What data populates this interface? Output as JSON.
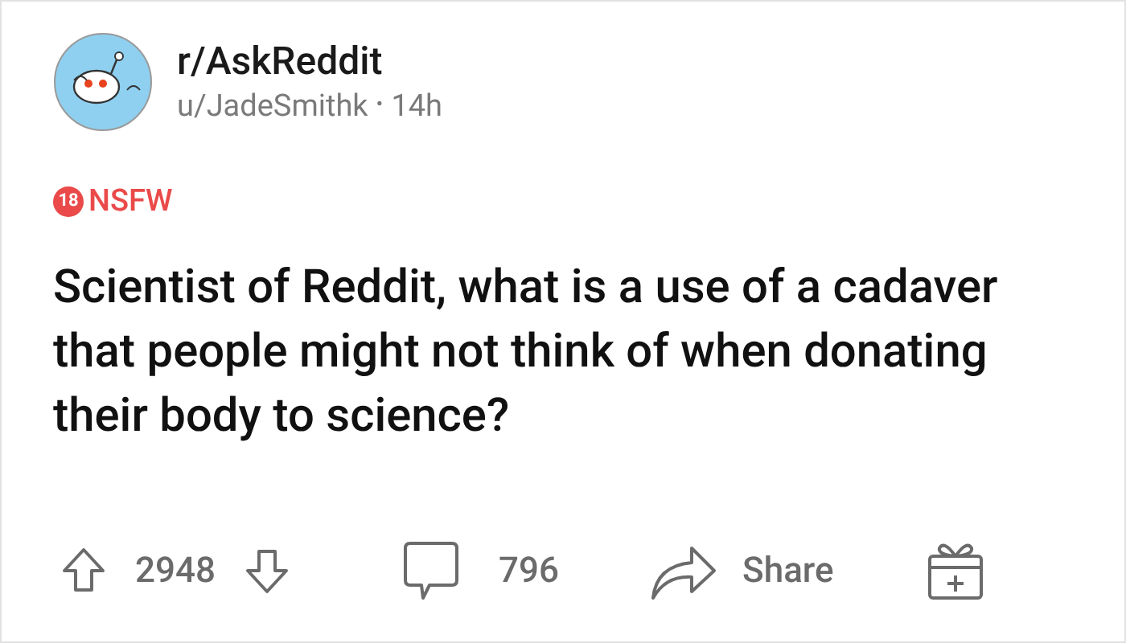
{
  "post": {
    "subreddit": "r/AskReddit",
    "author": "u/JadeSmithk",
    "separator": "•",
    "age": "14h",
    "nsfw": {
      "badge": "18",
      "label": "NSFW"
    },
    "title": "Scientist of Reddit, what is a use of a cadaver that people might not think of when donating their body to science?"
  },
  "actions": {
    "votes": "2948",
    "comments": "796",
    "share": "Share"
  }
}
